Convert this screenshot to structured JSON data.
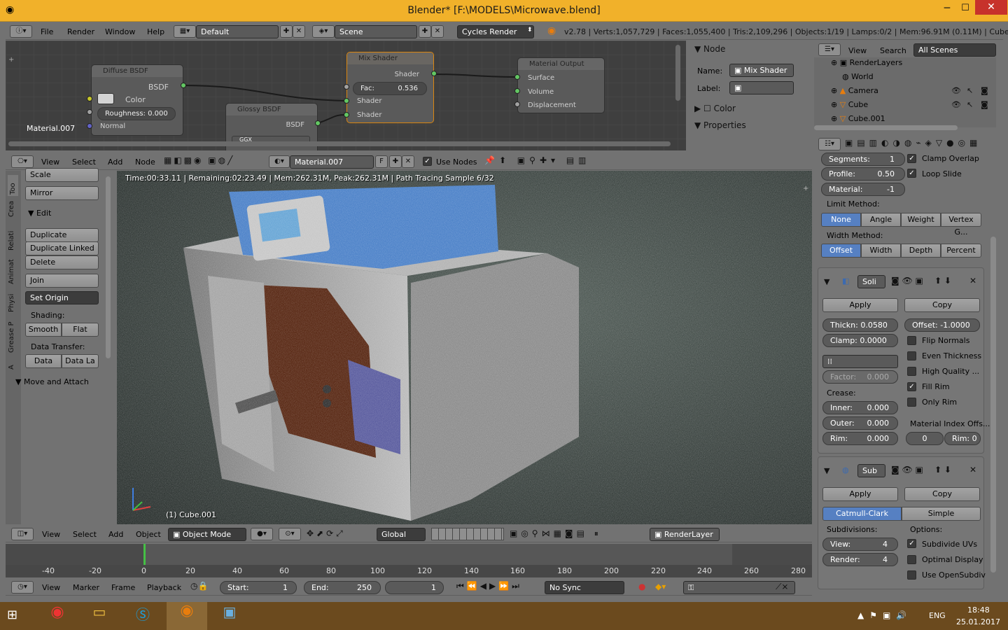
{
  "window": {
    "title": "Blender* [F:\\MODELS\\Microwave.blend]"
  },
  "info_bar": {
    "menus": [
      "File",
      "Render",
      "Window",
      "Help"
    ],
    "screen": "Default",
    "scene": "Scene",
    "engine": "Cycles Render",
    "stats": "v2.78 | Verts:1,057,729 | Faces:1,055,400 | Tris:2,109,296 | Objects:1/19 | Lamps:0/2 | Mem:96.91M (0.11M) | Cube.001"
  },
  "node_editor": {
    "material_label": "Material.007",
    "diffuse": {
      "title": "Diffuse BSDF",
      "out": "BSDF",
      "color": "Color",
      "roughness": "Roughness:",
      "roughness_val": "0.000",
      "normal": "Normal"
    },
    "glossy": {
      "title": "Glossy BSDF",
      "out": "BSDF",
      "dist": "GGX"
    },
    "mix": {
      "title": "Mix Shader",
      "out": "Shader",
      "fac": "Fac:",
      "fac_val": "0.536",
      "in1": "Shader",
      "in2": "Shader"
    },
    "output": {
      "title": "Material Output",
      "surface": "Surface",
      "volume": "Volume",
      "displacement": "Displacement"
    },
    "header": {
      "menus": [
        "View",
        "Select",
        "Add",
        "Node"
      ],
      "material": "Material.007",
      "f": "F",
      "use_nodes": "Use Nodes"
    }
  },
  "node_panel": {
    "node": "Node",
    "name_label": "Name:",
    "name_value": "Mix Shader",
    "label_label": "Label:",
    "color": "Color",
    "properties": "Properties"
  },
  "outliner": {
    "menus": [
      "View",
      "Search"
    ],
    "filter": "All Scenes",
    "items": [
      "RenderLayers",
      "World",
      "Camera",
      "Cube",
      "Cube.001"
    ]
  },
  "toolshelf": {
    "tabs": [
      "Too",
      "Crea",
      "Relati",
      "Animat",
      "Physi",
      "Grease P",
      "A"
    ],
    "scale": "Scale",
    "mirror": "Mirror",
    "edit": "Edit",
    "duplicate": "Duplicate",
    "duplicate_linked": "Duplicate Linked",
    "delete": "Delete",
    "join": "Join",
    "set_origin": "Set Origin",
    "shading": "Shading:",
    "smooth": "Smooth",
    "flat": "Flat",
    "data_transfer": "Data Transfer:",
    "data": "Data",
    "data_la": "Data La",
    "move_attach": "Move and Attach"
  },
  "viewport": {
    "status": "Time:00:33.11 | Remaining:02:23.49 | Mem:262.31M, Peak:262.31M | Path Tracing Sample 6/32",
    "object": "(1) Cube.001",
    "header": {
      "menus": [
        "View",
        "Select",
        "Add",
        "Object"
      ],
      "mode": "Object Mode",
      "orientation": "Global",
      "layer": "RenderLayer"
    }
  },
  "timeline": {
    "ticks": [
      "-40",
      "-20",
      "0",
      "20",
      "40",
      "60",
      "80",
      "100",
      "120",
      "140",
      "160",
      "180",
      "200",
      "220",
      "240",
      "260",
      "280"
    ],
    "menus": [
      "View",
      "Marker",
      "Frame",
      "Playback"
    ],
    "start_label": "Start:",
    "start": "1",
    "end_label": "End:",
    "end": "250",
    "current": "1",
    "sync": "No Sync"
  },
  "properties": {
    "bevel": {
      "segments_label": "Segments:",
      "segments": "1",
      "profile_label": "Profile:",
      "profile": "0.50",
      "material_label": "Material:",
      "material": "-1",
      "clamp_overlap": "Clamp Overlap",
      "loop_slide": "Loop Slide",
      "limit_method": "Limit Method:",
      "limit_opts": [
        "None",
        "Angle",
        "Weight",
        "Vertex G..."
      ],
      "width_method": "Width Method:",
      "width_opts": [
        "Offset",
        "Width",
        "Depth",
        "Percent"
      ]
    },
    "solidify": {
      "name": "Soli",
      "apply": "Apply",
      "copy": "Copy",
      "thickness": "Thickn: 0.0580",
      "offset": "Offset: -1.0000",
      "clamp": "Clamp: 0.0000",
      "flip_normals": "Flip Normals",
      "even_thickness": "Even Thickness",
      "high_quality": "High Quality ...",
      "factor": "Factor:",
      "factor_val": "0.000",
      "fill_rim": "Fill Rim",
      "only_rim": "Only Rim",
      "crease": "Crease:",
      "inner_label": "Inner:",
      "inner": "0.000",
      "outer_label": "Outer:",
      "outer": "0.000",
      "rim_label": "Rim:",
      "rim": "0.000",
      "mat_index": "Material Index Offs...",
      "mi_val": "0",
      "rim_val": "Rim: 0"
    },
    "subsurf": {
      "name": "Sub",
      "apply": "Apply",
      "copy": "Copy",
      "catmull": "Catmull-Clark",
      "simple": "Simple",
      "subdivisions": "Subdivisions:",
      "options": "Options:",
      "view_label": "View:",
      "view": "4",
      "render_label": "Render:",
      "render": "4",
      "subdivide_uvs": "Subdivide UVs",
      "optimal_display": "Optimal Display",
      "use_opensubdiv": "Use OpenSubdiv"
    }
  },
  "taskbar": {
    "lang": "ENG",
    "time": "18:48",
    "date": "25.01.2017"
  },
  "colors": {
    "accent": "#5680c2",
    "orange": "#e87d0d",
    "socket_green": "#63c763",
    "socket_yellow": "#c7c729",
    "socket_gray": "#a1a1a1",
    "socket_blue": "#6363c7"
  }
}
